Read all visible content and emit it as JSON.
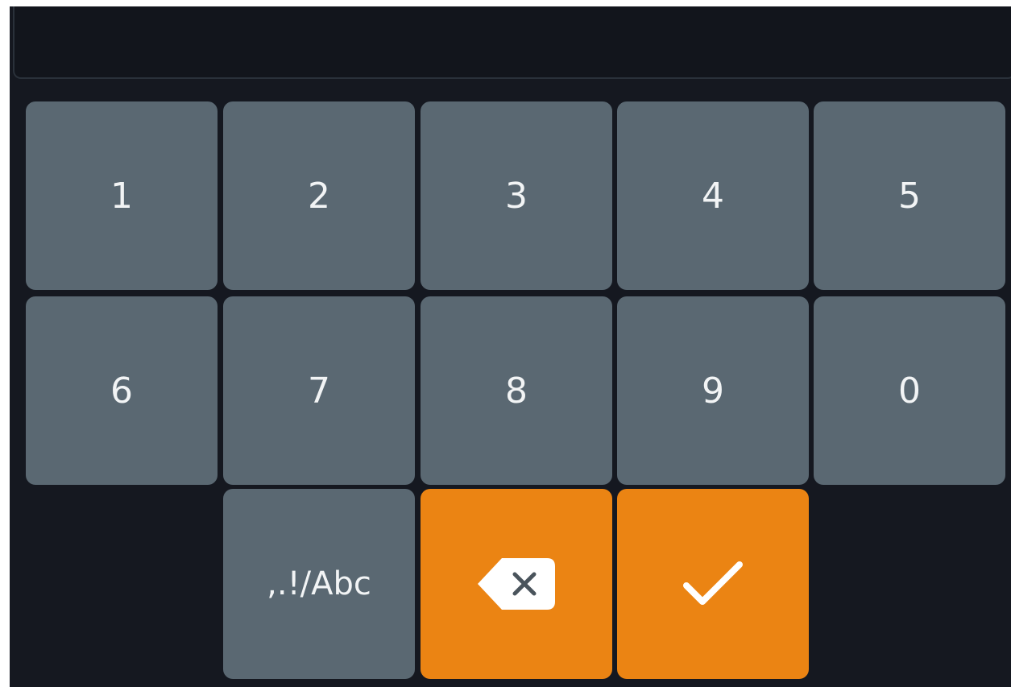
{
  "input": {
    "value": ""
  },
  "keypad": {
    "row1": [
      "1",
      "2",
      "3",
      "4",
      "5"
    ],
    "row2": [
      "6",
      "7",
      "8",
      "9",
      "0"
    ],
    "mode_switch_label": ",.!/Abc",
    "backspace_icon": "backspace-icon",
    "confirm_icon": "checkmark-icon"
  },
  "colors": {
    "background": "#151820",
    "key": "#5a6872",
    "accent": "#eb8413",
    "text": "#f2f4f5"
  }
}
